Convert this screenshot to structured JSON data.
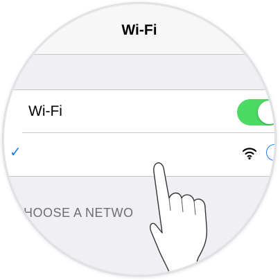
{
  "navbar": {
    "title": "Wi-Fi"
  },
  "wifi_cell": {
    "label": "Wi-Fi",
    "toggle_on": true
  },
  "network_cell": {
    "selected": true,
    "check_glyph": "✓"
  },
  "section": {
    "header": "HOOSE A NETWO"
  },
  "icons": {
    "check": "checkmark-icon",
    "wifi": "wifi-signal-icon",
    "info": "info-icon",
    "hand": "pointing-hand-icon"
  },
  "colors": {
    "toggle_on": "#4cd964",
    "accent": "#1a7cf5",
    "background": "#efeff4",
    "separator": "#c8c7cc"
  }
}
